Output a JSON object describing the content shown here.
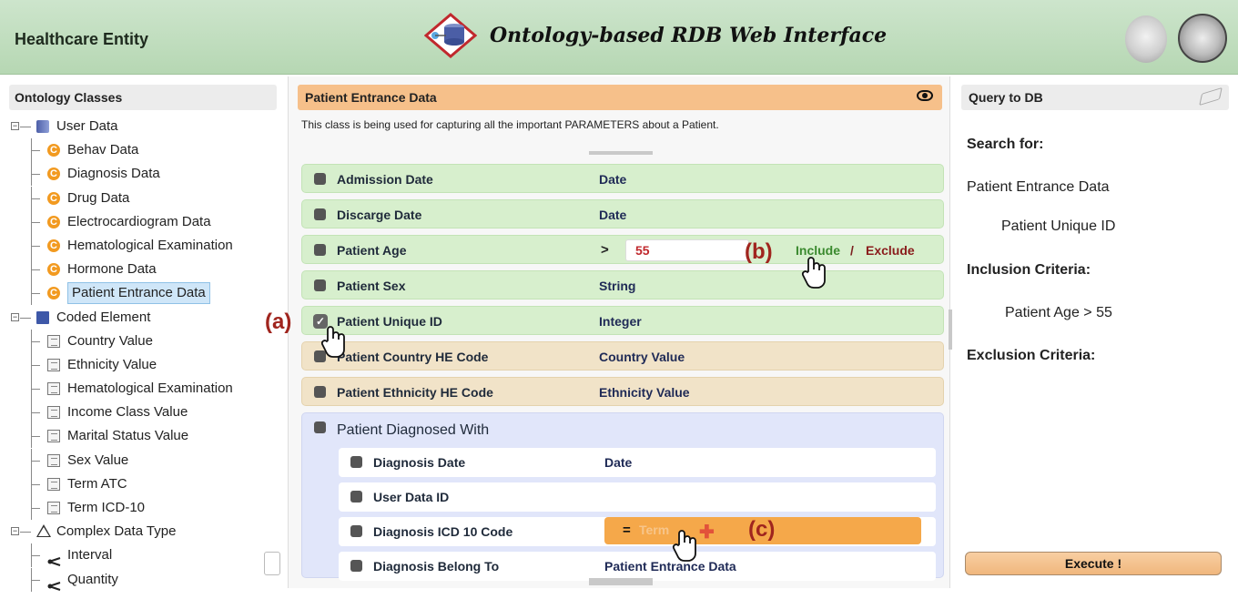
{
  "header": {
    "app_title": "Healthcare Entity",
    "brand": "Ontology-based RDB Web Interface"
  },
  "left_panel": {
    "title": "Ontology Classes",
    "tree": [
      {
        "label": "User Data",
        "icon": "database-icon",
        "level": 0
      },
      {
        "label": "Behav Data",
        "icon": "class-icon",
        "level": 1
      },
      {
        "label": "Diagnosis Data",
        "icon": "class-icon",
        "level": 1
      },
      {
        "label": "Drug Data",
        "icon": "class-icon",
        "level": 1
      },
      {
        "label": "Electrocardiogram Data",
        "icon": "class-icon",
        "level": 1
      },
      {
        "label": "Hematological Examination",
        "icon": "class-icon",
        "level": 1
      },
      {
        "label": "Hormone Data",
        "icon": "class-icon",
        "level": 1
      },
      {
        "label": "Patient Entrance Data",
        "icon": "class-icon",
        "level": 1,
        "selected": true
      },
      {
        "label": "Coded Element",
        "icon": "database-icon",
        "level": 0
      },
      {
        "label": "Country Value",
        "icon": "table-icon",
        "level": 1
      },
      {
        "label": "Ethnicity Value",
        "icon": "table-icon",
        "level": 1
      },
      {
        "label": "Hematological Examination",
        "icon": "table-icon",
        "level": 1
      },
      {
        "label": "Income Class Value",
        "icon": "table-icon",
        "level": 1
      },
      {
        "label": "Marital Status Value",
        "icon": "table-icon",
        "level": 1
      },
      {
        "label": "Sex Value",
        "icon": "table-icon",
        "level": 1
      },
      {
        "label": "Term ATC",
        "icon": "table-icon",
        "level": 1
      },
      {
        "label": "Term ICD-10",
        "icon": "table-icon",
        "level": 1
      },
      {
        "label": "Complex Data Type",
        "icon": "triangle-icon",
        "level": 0
      },
      {
        "label": "Interval",
        "icon": "link-icon",
        "level": 1
      },
      {
        "label": "Quantity",
        "icon": "link-icon",
        "level": 1
      }
    ]
  },
  "center_panel": {
    "title": "Patient Entrance Data",
    "description": "This class is being used for capturing all the important PARAMETERS about a Patient.",
    "rows": [
      {
        "name": "Admission Date",
        "type": "Date",
        "color": "green"
      },
      {
        "name": "Discarge Date",
        "type": "Date",
        "color": "green"
      },
      {
        "name": "Patient Age",
        "operator": ">",
        "value": "55",
        "include": "Include",
        "separator": "/",
        "exclude": "Exclude",
        "color": "green"
      },
      {
        "name": "Patient Sex",
        "type": "String",
        "color": "green"
      },
      {
        "name": "Patient Unique ID",
        "type": "Integer",
        "color": "green",
        "checked": true
      },
      {
        "name": "Patient Country HE Code",
        "type": "Country Value",
        "color": "tan"
      },
      {
        "name": "Patient Ethnicity HE Code",
        "type": "Ethnicity Value",
        "color": "tan"
      }
    ],
    "group": {
      "name": "Patient Diagnosed With",
      "subrows": [
        {
          "name": "Diagnosis Date",
          "type": "Date"
        },
        {
          "name": "User Data ID",
          "type": ""
        },
        {
          "name": "Diagnosis ICD 10 Code",
          "operator": "=",
          "value": "Term"
        },
        {
          "name": "Diagnosis Belong To",
          "type": "Patient Entrance Data"
        }
      ]
    }
  },
  "annotations": {
    "a": "(a)",
    "b": "(b)",
    "c": "(c)"
  },
  "right_panel": {
    "title": "Query to DB",
    "search_for_label": "Search for:",
    "search_class": "Patient Entrance Data",
    "search_field": "Patient Unique ID",
    "inclusion_label": "Inclusion Criteria:",
    "inclusion_item": "Patient Age > 55",
    "exclusion_label": "Exclusion Criteria:",
    "execute_label": "Execute !"
  },
  "colors": {
    "header_bg": "#b6d7b3",
    "center_head_bg": "#f6c08a",
    "row_green": "#d7efcd",
    "row_tan": "#f1e3c8",
    "group_bg": "#e1e6fa",
    "accent_red": "#a0251e"
  }
}
